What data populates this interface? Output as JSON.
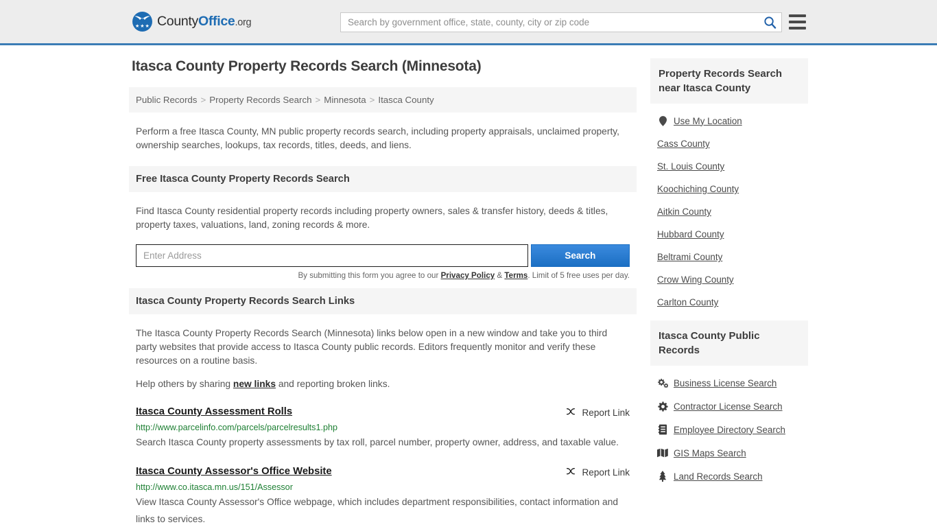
{
  "header": {
    "logo": {
      "part1": "County",
      "part2": "Office",
      "tld": ".org",
      "icon": "eagle-seal-logo"
    },
    "search": {
      "placeholder": "Search by government office, state, county, city or zip code",
      "value": "",
      "icon": "search-icon"
    },
    "menu_icon": "hamburger-menu-icon"
  },
  "page": {
    "title": "Itasca County Property Records Search (Minnesota)",
    "breadcrumb": [
      "Public Records",
      "Property Records Search",
      "Minnesota",
      "Itasca County"
    ],
    "breadcrumb_separator": ">",
    "intro": "Perform a free Itasca County, MN public property records search, including property appraisals, unclaimed property, ownership searches, lookups, tax records, titles, deeds, and liens."
  },
  "search_section": {
    "heading": "Free Itasca County Property Records Search",
    "description": "Find Itasca County residential property records including property owners, sales & transfer history, deeds & titles, property taxes, valuations, land, zoning records & more.",
    "input_placeholder": "Enter Address",
    "input_value": "",
    "button_label": "Search",
    "fineprint_prefix": "By submitting this form you agree to our ",
    "privacy_label": "Privacy Policy",
    "fineprint_amp": " & ",
    "terms_label": "Terms",
    "fineprint_suffix": ". Limit of 5 free uses per day."
  },
  "links_section": {
    "heading": "Itasca County Property Records Search Links",
    "paragraph": "The Itasca County Property Records Search (Minnesota) links below open in a new window and take you to third party websites that provide access to Itasca County public records. Editors frequently monitor and verify these resources on a routine basis.",
    "help_prefix": "Help others by sharing ",
    "help_link": "new links",
    "help_suffix": " and reporting broken links.",
    "report_label": "Report Link",
    "report_icon": "broken-link-icon",
    "results": [
      {
        "title": "Itasca County Assessment Rolls",
        "url": "http://www.parcelinfo.com/parcels/parcelresults1.php",
        "description": "Search Itasca County property assessments by tax roll, parcel number, property owner, address, and taxable value."
      },
      {
        "title": "Itasca County Assessor's Office Website",
        "url": "http://www.co.itasca.mn.us/151/Assessor",
        "description": "View Itasca County Assessor's Office webpage, which includes department responsibilities, contact information and links to services."
      }
    ]
  },
  "sidebar": {
    "nearby": {
      "heading": "Property Records Search near Itasca County",
      "items": [
        {
          "label": "Use My Location",
          "icon": "map-pin-icon"
        },
        {
          "label": "Cass County",
          "icon": ""
        },
        {
          "label": "St. Louis County",
          "icon": ""
        },
        {
          "label": "Koochiching County",
          "icon": ""
        },
        {
          "label": "Aitkin County",
          "icon": ""
        },
        {
          "label": "Hubbard County",
          "icon": ""
        },
        {
          "label": "Beltrami County",
          "icon": ""
        },
        {
          "label": "Crow Wing County",
          "icon": ""
        },
        {
          "label": "Carlton County",
          "icon": ""
        }
      ]
    },
    "public_records": {
      "heading": "Itasca County Public Records",
      "items": [
        {
          "label": "Business License Search",
          "icon": "cogs-icon"
        },
        {
          "label": "Contractor License Search",
          "icon": "cog-icon"
        },
        {
          "label": "Employee Directory Search",
          "icon": "address-book-icon"
        },
        {
          "label": "GIS Maps Search",
          "icon": "map-icon"
        },
        {
          "label": "Land Records Search",
          "icon": "tree-icon"
        }
      ]
    }
  },
  "colors": {
    "brand_blue": "#1e6cb3",
    "header_rule": "#3b7cb5",
    "button_blue": "#1c6fc3",
    "url_green": "#1d7f33",
    "panel_bg": "#f5f5f5"
  }
}
